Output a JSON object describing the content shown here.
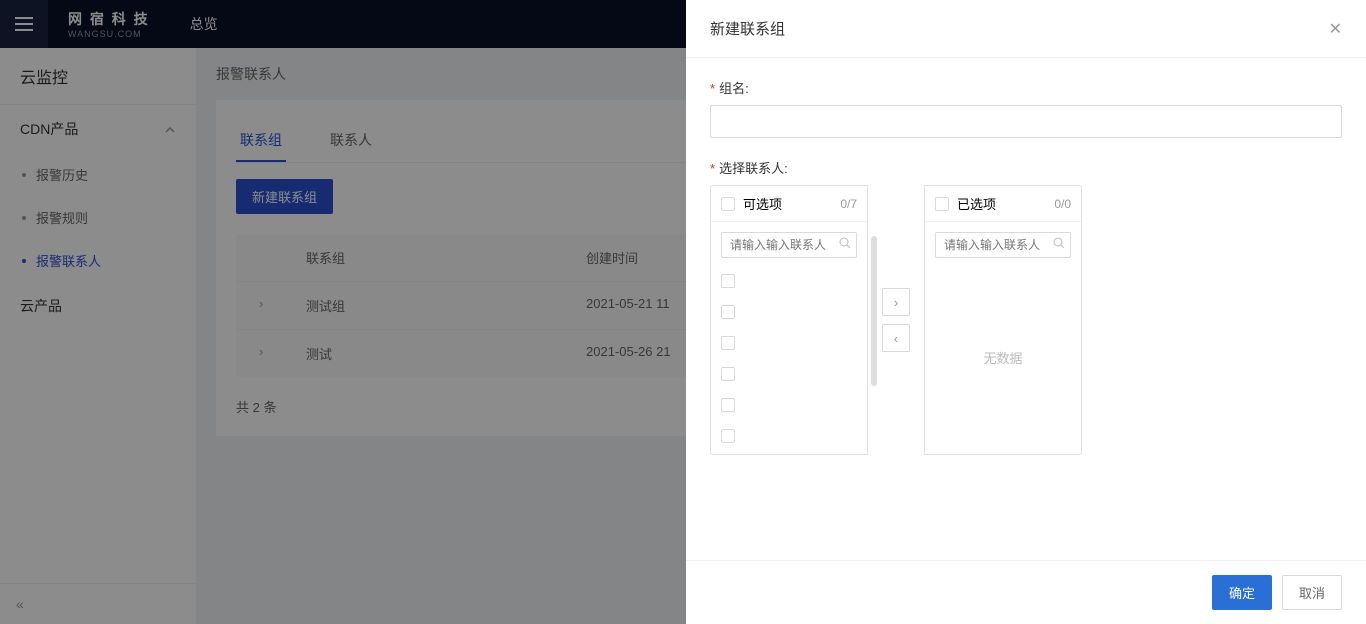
{
  "header": {
    "logo_cn": "网 宿 科 技",
    "logo_en": "WANGSU.COM",
    "overview": "总览"
  },
  "sidebar": {
    "title": "云监控",
    "cdn_label": "CDN产品",
    "items": {
      "history": "报警历史",
      "rules": "报警规则",
      "contacts": "报警联系人"
    },
    "cloud_label": "云产品",
    "collapse": "«"
  },
  "content": {
    "breadcrumb": "报警联系人",
    "tabs": {
      "group": "联系组",
      "person": "联系人"
    },
    "new_btn": "新建联系组",
    "columns": {
      "name": "联系组",
      "date": "创建时间"
    },
    "rows": [
      {
        "name": "测试组",
        "date": "2021-05-21 11"
      },
      {
        "name": "测试",
        "date": "2021-05-26 21"
      }
    ],
    "total": "共 2 条"
  },
  "drawer": {
    "title": "新建联系组",
    "group_name_label": "组名:",
    "select_label": "选择联系人:",
    "available": "可选项",
    "available_count": "0/7",
    "selected": "已选项",
    "selected_count": "0/0",
    "search_placeholder": "请输入输入联系人",
    "empty": "无数据",
    "ok": "确定",
    "cancel": "取消"
  }
}
